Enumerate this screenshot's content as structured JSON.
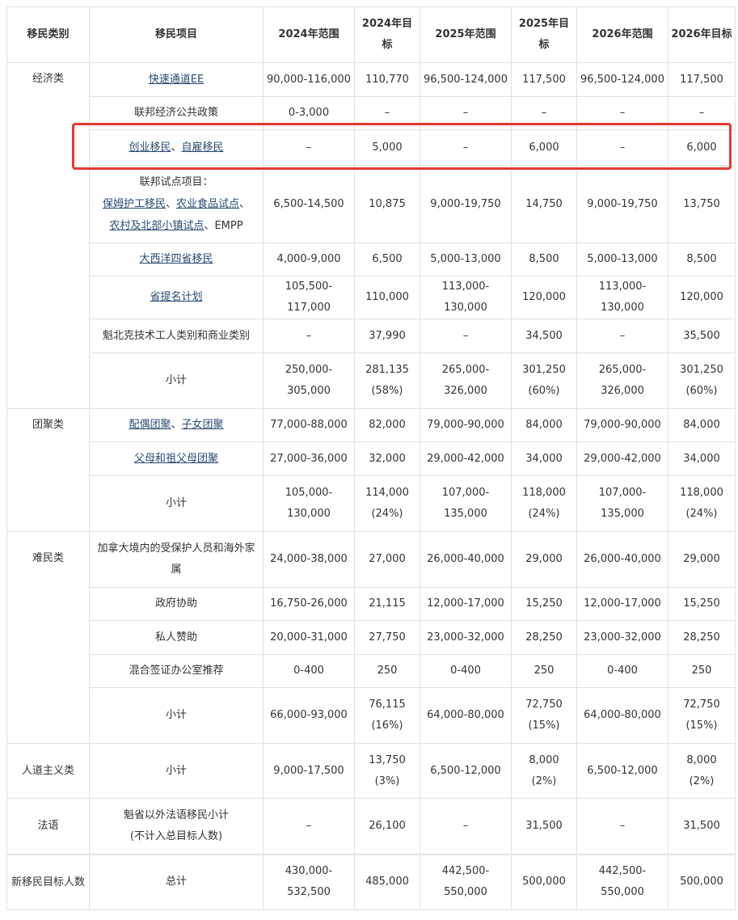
{
  "header": {
    "category": "移民类别",
    "program": "移民项目",
    "r2024": "2024年范围",
    "t2024": "2024年目标",
    "r2025": "2025年范围",
    "t2025": "2025年目标",
    "r2026": "2026年范围",
    "t2026": "2026年目标"
  },
  "economic": {
    "category": "经济类",
    "ee": {
      "program": "快速通道EE",
      "r2024": "90,000-116,000",
      "t2024": "110,770",
      "r2025": "96,500-124,000",
      "t2025": "117,500",
      "r2026": "96,500-124,000",
      "t2026": "117,500"
    },
    "fpp": {
      "program": "联邦经济公共政策",
      "r2024": "0-3,000",
      "t2024": "–",
      "r2025": "–",
      "t2025": "–",
      "r2026": "–",
      "t2026": "–"
    },
    "startup": {
      "link1": "创业移民",
      "sep": "、",
      "link2": "自雇移民",
      "r2024": "–",
      "t2024": "5,000",
      "r2025": "–",
      "t2025": "6,000",
      "r2026": "–",
      "t2026": "6,000"
    },
    "pilots": {
      "line1": "联邦试点项目：",
      "l1": "保姆护工移民",
      "sep1": "、",
      "l2": "农业食品试点",
      "sep2": "、",
      "l3": "农村及北部小镇试点",
      "sep3": "、",
      "l4": "EMPP",
      "r2024": "6,500-14,500",
      "t2024": "10,875",
      "r2025": "9,000-19,750",
      "t2025": "14,750",
      "r2026": "9,000-19,750",
      "t2026": "13,750"
    },
    "aip": {
      "program": "大西洋四省移民",
      "r2024": "4,000-9,000",
      "t2024": "6,500",
      "r2025": "5,000-13,000",
      "t2025": "8,500",
      "r2026": "5,000-13,000",
      "t2026": "8,500"
    },
    "pnp": {
      "program": "省提名计划",
      "r2024": "105,500-117,000",
      "t2024": "110,000",
      "r2025": "113,000-130,000",
      "t2025": "120,000",
      "r2026": "113,000-130,000",
      "t2026": "120,000"
    },
    "quebec": {
      "program": "魁北克技术工人类别和商业类别",
      "r2024": "–",
      "t2024": "37,990",
      "r2025": "–",
      "t2025": "34,500",
      "r2026": "–",
      "t2026": "35,500"
    },
    "subtotal": {
      "label": "小计",
      "r2024a": "250,000-",
      "r2024b": "305,000",
      "t2024a": "281,135",
      "t2024b": "(58%)",
      "r2025a": "265,000-",
      "r2025b": "326,000",
      "t2025a": "301,250",
      "t2025b": "(60%)",
      "r2026a": "265,000-",
      "r2026b": "326,000",
      "t2026a": "301,250",
      "t2026b": "(60%)"
    }
  },
  "family": {
    "category": "团聚类",
    "spouse": {
      "l1": "配偶团聚",
      "sep": "、",
      "l2": "子女团聚",
      "r2024": "77,000-88,000",
      "t2024": "82,000",
      "r2025": "79,000-90,000",
      "t2025": "84,000",
      "r2026": "79,000-90,000",
      "t2026": "84,000"
    },
    "parents": {
      "program": "父母和祖父母团聚",
      "r2024": "27,000-36,000",
      "t2024": "32,000",
      "r2025": "29,000-42,000",
      "t2025": "34,000",
      "r2026": "29,000-42,000",
      "t2026": "34,000"
    },
    "subtotal": {
      "label": "小计",
      "r2024a": "105,000-",
      "r2024b": "130,000",
      "t2024a": "114,000",
      "t2024b": "(24%)",
      "r2025a": "107,000-",
      "r2025b": "135,000",
      "t2025a": "118,000",
      "t2025b": "(24%)",
      "r2026a": "107,000-",
      "r2026b": "135,000",
      "t2026a": "118,000",
      "t2026b": "(24%)"
    }
  },
  "refugee": {
    "category": "难民类",
    "protected": {
      "program": "加拿大境内的受保护人员和海外家属",
      "r2024": "24,000-38,000",
      "t2024": "27,000",
      "r2025": "26,000-40,000",
      "t2025": "29,000",
      "r2026": "26,000-40,000",
      "t2026": "29,000"
    },
    "gov": {
      "program": "政府协助",
      "r2024": "16,750-26,000",
      "t2024": "21,115",
      "r2025": "12,000-17,000",
      "t2025": "15,250",
      "r2026": "12,000-17,000",
      "t2026": "15,250"
    },
    "private": {
      "program": "私人赞助",
      "r2024": "20,000-31,000",
      "t2024": "27,750",
      "r2025": "23,000-32,000",
      "t2025": "28,250",
      "r2026": "23,000-32,000",
      "t2026": "28,250"
    },
    "bvor": {
      "program": "混合签证办公室推荐",
      "r2024": "0-400",
      "t2024": "250",
      "r2025": "0-400",
      "t2025": "250",
      "r2026": "0-400",
      "t2026": "250"
    },
    "subtotal": {
      "label": "小计",
      "r2024": "66,000-93,000",
      "t2024a": "76,115",
      "t2024b": "(16%)",
      "r2025": "64,000-80,000",
      "t2025a": "72,750",
      "t2025b": "(15%)",
      "r2026": "64,000-80,000",
      "t2026a": "72,750",
      "t2026b": "(15%)"
    }
  },
  "humanitarian": {
    "category": "人道主义类",
    "subtotal": {
      "label": "小计",
      "r2024": "9,000-17,500",
      "t2024a": "13,750",
      "t2024b": "(3%)",
      "r2025": "6,500-12,000",
      "t2025a": "8,000",
      "t2025b": "(2%)",
      "r2026": "6,500-12,000",
      "t2026a": "8,000",
      "t2026b": "(2%)"
    }
  },
  "french": {
    "category": "法语",
    "line1": "魁省以外法语移民小计",
    "line2": "(不计入总目标人数)",
    "r2024": "–",
    "t2024": "26,100",
    "r2025": "–",
    "t2025": "31,500",
    "r2026": "–",
    "t2026": "31,500"
  },
  "total": {
    "category": "新移民目标人数",
    "label": "总计",
    "r2024a": "430,000-",
    "r2024b": "532,500",
    "t2024": "485,000",
    "r2025a": "442,500-",
    "r2025b": "550,000",
    "t2025": "500,000",
    "r2026a": "442,500-",
    "r2026b": "550,000",
    "t2026": "500,000"
  },
  "colors": {
    "highlight": "#e53935",
    "link": "#2a4a73",
    "border": "#e2e2e2"
  }
}
